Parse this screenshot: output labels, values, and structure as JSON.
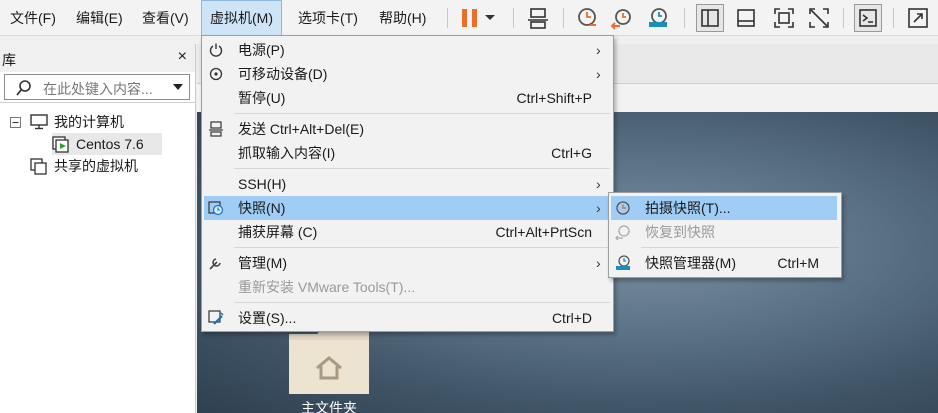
{
  "menubar": {
    "file": "文件(F)",
    "edit": "编辑(E)",
    "view": "查看(V)",
    "vm": "虚拟机(M)",
    "tabs": "选项卡(T)",
    "help": "帮助(H)"
  },
  "library": {
    "title": "库",
    "close": "×",
    "search_placeholder": "在此处键入内容...",
    "tree": {
      "my_computer": "我的计算机",
      "vm_name": "Centos 7.6",
      "shared_vms": "共享的虚拟机"
    }
  },
  "vm_menu": {
    "items": [
      {
        "label": "电源(P)",
        "shortcut": "",
        "submenu": true,
        "icon": "power-icon"
      },
      {
        "label": "可移动设备(D)",
        "shortcut": "",
        "submenu": true,
        "icon": "removable-device-icon"
      },
      {
        "label": "暂停(U)",
        "shortcut": "Ctrl+Shift+P",
        "submenu": false,
        "icon": ""
      },
      {
        "label": "发送 Ctrl+Alt+Del(E)",
        "shortcut": "",
        "submenu": false,
        "icon": "send-keys-icon"
      },
      {
        "label": "抓取输入内容(I)",
        "shortcut": "Ctrl+G",
        "submenu": false,
        "icon": ""
      },
      {
        "label": "SSH(H)",
        "shortcut": "",
        "submenu": true,
        "icon": ""
      },
      {
        "label": "快照(N)",
        "shortcut": "",
        "submenu": true,
        "icon": "snapshot-icon"
      },
      {
        "label": "捕获屏幕 (C)",
        "shortcut": "Ctrl+Alt+PrtScn",
        "submenu": false,
        "icon": ""
      },
      {
        "label": "管理(M)",
        "shortcut": "",
        "submenu": true,
        "icon": "wrench-icon"
      },
      {
        "label": "重新安装 VMware Tools(T)...",
        "shortcut": "",
        "submenu": false,
        "icon": ""
      },
      {
        "label": "设置(S)...",
        "shortcut": "Ctrl+D",
        "submenu": false,
        "icon": "settings-icon"
      }
    ],
    "submenu_arrow": "›"
  },
  "snapshot_menu": {
    "items": [
      {
        "label": "拍摄快照(T)...",
        "shortcut": "",
        "icon": "take-snapshot-icon"
      },
      {
        "label": "恢复到快照",
        "shortcut": "",
        "icon": "revert-snapshot-icon"
      },
      {
        "label": "快照管理器(M)",
        "shortcut": "Ctrl+M",
        "icon": "snapshot-manager-icon"
      }
    ]
  },
  "desktop": {
    "home_folder_label": "主文件夹"
  },
  "colors": {
    "menu_highlight": "#9fcdf6",
    "active_menu": "#cfe4f7",
    "pause_orange": "#e8702a",
    "disabled_text": "#9a9a9a"
  }
}
